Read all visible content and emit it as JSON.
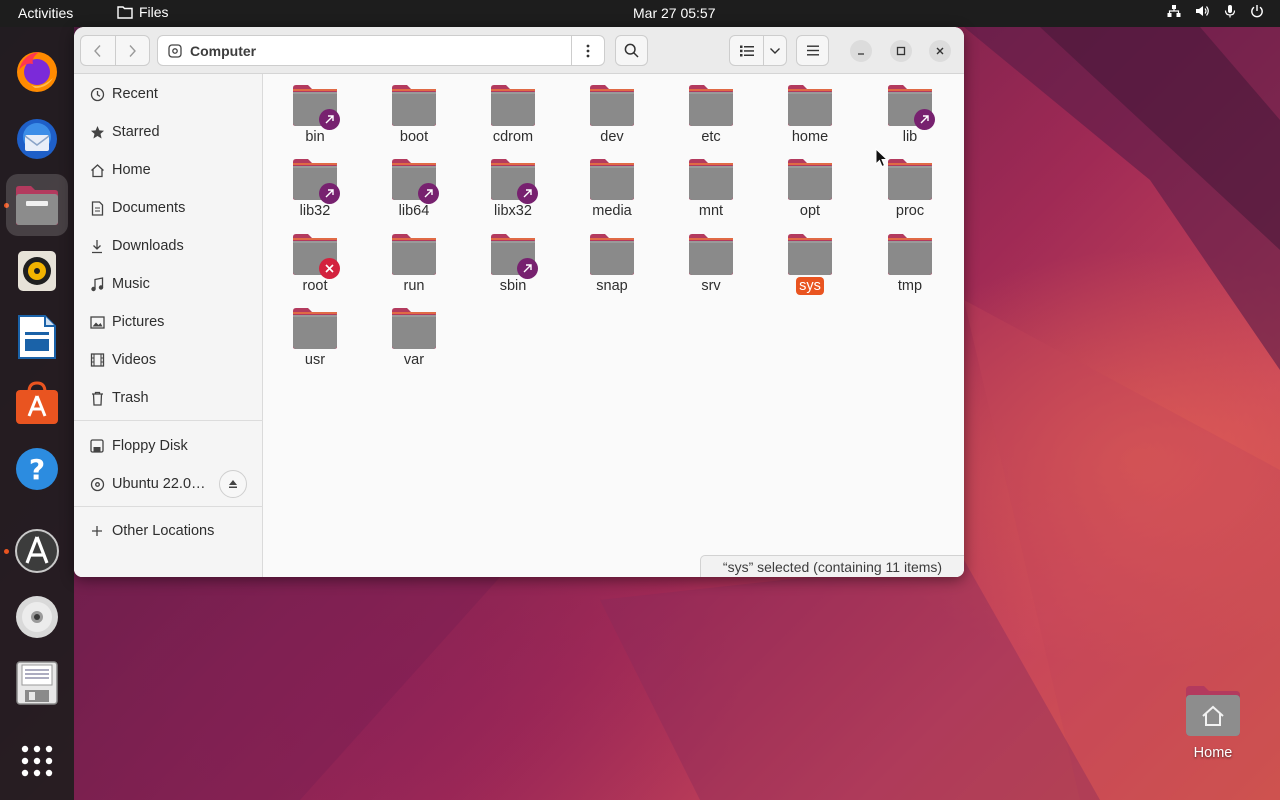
{
  "topbar": {
    "activities": "Activities",
    "app_name": "Files",
    "clock": "Mar 27  05:57",
    "tray_icons": [
      "network-icon",
      "volume-icon",
      "mic-icon",
      "power-icon"
    ]
  },
  "dock": {
    "items": [
      "firefox-icon",
      "thunderbird-icon",
      "files-icon",
      "rhythmbox-icon",
      "libreoffice-writer-icon",
      "app-center-icon",
      "help-icon",
      "software-updater-icon",
      "cd-drive-icon",
      "floppy-icon",
      "show-apps-icon"
    ]
  },
  "window": {
    "location": "Computer",
    "status": "“sys” selected  (containing 11 items)"
  },
  "sidebar": {
    "places": [
      {
        "label": "Recent",
        "icon": "clock-icon"
      },
      {
        "label": "Starred",
        "icon": "star-icon"
      },
      {
        "label": "Home",
        "icon": "home-icon"
      },
      {
        "label": "Documents",
        "icon": "document-icon"
      },
      {
        "label": "Downloads",
        "icon": "download-icon"
      },
      {
        "label": "Music",
        "icon": "music-icon"
      },
      {
        "label": "Pictures",
        "icon": "picture-icon"
      },
      {
        "label": "Videos",
        "icon": "video-icon"
      },
      {
        "label": "Trash",
        "icon": "trash-icon"
      }
    ],
    "devices": [
      {
        "label": "Floppy Disk",
        "icon": "floppy-icon"
      },
      {
        "label": "Ubuntu 22.0…",
        "icon": "disc-icon"
      }
    ],
    "other": {
      "label": "Other Locations",
      "icon": "plus-icon"
    }
  },
  "files": [
    {
      "name": "bin",
      "emblem": "link"
    },
    {
      "name": "boot"
    },
    {
      "name": "cdrom"
    },
    {
      "name": "dev"
    },
    {
      "name": "etc"
    },
    {
      "name": "home"
    },
    {
      "name": "lib",
      "emblem": "link"
    },
    {
      "name": "lib32",
      "emblem": "link"
    },
    {
      "name": "lib64",
      "emblem": "link"
    },
    {
      "name": "libx32",
      "emblem": "link"
    },
    {
      "name": "media"
    },
    {
      "name": "mnt"
    },
    {
      "name": "opt"
    },
    {
      "name": "proc"
    },
    {
      "name": "root",
      "emblem": "locked"
    },
    {
      "name": "run"
    },
    {
      "name": "sbin",
      "emblem": "link"
    },
    {
      "name": "snap"
    },
    {
      "name": "srv"
    },
    {
      "name": "sys",
      "selected": true
    },
    {
      "name": "tmp"
    },
    {
      "name": "usr"
    },
    {
      "name": "var"
    }
  ],
  "desktop": {
    "home_label": "Home"
  },
  "colors": {
    "accent": "#e95420",
    "link_emblem": "#77216f",
    "locked_emblem": "#d3223e"
  }
}
